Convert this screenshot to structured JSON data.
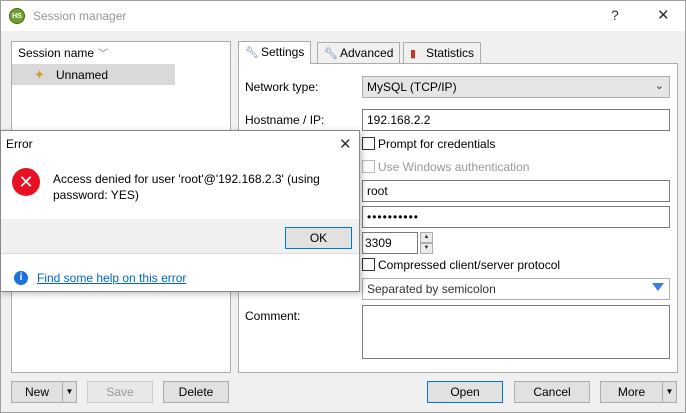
{
  "window": {
    "title": "Session manager",
    "app_icon": "HS",
    "help_glyph": "?",
    "close_glyph": "✕"
  },
  "session_list": {
    "header": "Session name",
    "sessions": [
      {
        "name": "Unnamed"
      }
    ]
  },
  "tabs": [
    {
      "label": "Settings",
      "active": true
    },
    {
      "label": "Advanced",
      "active": false
    },
    {
      "label": "Statistics",
      "active": false
    }
  ],
  "settings": {
    "network_type_label": "Network type:",
    "network_type_value": "MySQL (TCP/IP)",
    "hostname_label": "Hostname / IP:",
    "hostname_value": "192.168.2.2",
    "prompt_credentials_label": "Prompt for credentials",
    "windows_auth_label": "Use Windows authentication",
    "user_value": "root",
    "password_value": "••••••••••",
    "port_value": "3309",
    "compressed_label": "Compressed client/server protocol",
    "databases_value": "Separated by semicolon",
    "comment_label": "Comment:"
  },
  "buttons": {
    "new": "New",
    "save": "Save",
    "delete": "Delete",
    "open": "Open",
    "cancel": "Cancel",
    "more": "More"
  },
  "error_dialog": {
    "title": "Error",
    "close_glyph": "✕",
    "message": "Access denied for user 'root'@'192.168.2.3' (using password: YES)",
    "ok_label": "OK",
    "help_link": "Find some help on this error"
  },
  "colors": {
    "accent": "#0078d7",
    "error": "#e81123",
    "link": "#0066cc"
  }
}
